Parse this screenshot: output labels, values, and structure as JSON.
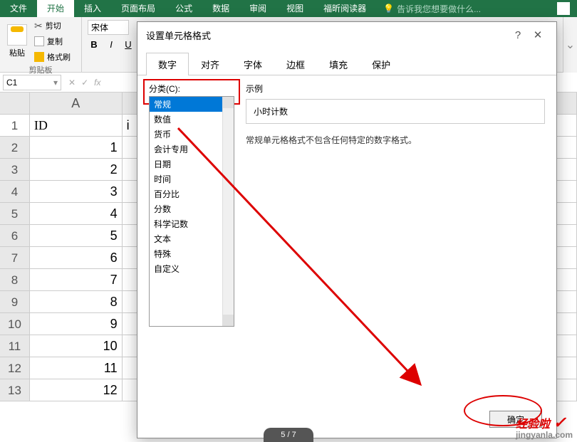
{
  "ribbon": {
    "tabs": [
      "文件",
      "开始",
      "插入",
      "页面布局",
      "公式",
      "数据",
      "审阅",
      "视图",
      "福昕阅读器"
    ],
    "active": "开始",
    "tell_me": "告诉我您想要做什么..."
  },
  "clipboard": {
    "paste": "粘贴",
    "cut": "剪切",
    "copy": "复制",
    "brush": "格式刷",
    "group": "剪贴板"
  },
  "font": {
    "name": "宋体",
    "bold": "B",
    "italic": "I",
    "underline": "U"
  },
  "formula_bar": {
    "name_box": "C1",
    "fx": "fx"
  },
  "sheet": {
    "columns": [
      "A"
    ],
    "col_b_partial": "i",
    "rows": [
      {
        "n": "1",
        "A": "ID"
      },
      {
        "n": "2",
        "A": "1"
      },
      {
        "n": "3",
        "A": "2"
      },
      {
        "n": "4",
        "A": "3"
      },
      {
        "n": "5",
        "A": "4"
      },
      {
        "n": "6",
        "A": "5"
      },
      {
        "n": "7",
        "A": "6"
      },
      {
        "n": "8",
        "A": "7"
      },
      {
        "n": "9",
        "A": "8"
      },
      {
        "n": "10",
        "A": "9"
      },
      {
        "n": "11",
        "A": "10"
      },
      {
        "n": "12",
        "A": "11"
      },
      {
        "n": "13",
        "A": "12"
      }
    ]
  },
  "dialog": {
    "title": "设置单元格格式",
    "tabs": [
      "数字",
      "对齐",
      "字体",
      "边框",
      "填充",
      "保护"
    ],
    "active_tab": "数字",
    "category_label": "分类(C):",
    "categories": [
      "常规",
      "数值",
      "货币",
      "会计专用",
      "日期",
      "时间",
      "百分比",
      "分数",
      "科学记数",
      "文本",
      "特殊",
      "自定义"
    ],
    "selected_category": "常规",
    "sample_label": "示例",
    "sample_value": "小时计数",
    "description": "常规单元格格式不包含任何特定的数字格式。",
    "ok": "确定"
  },
  "page_indicator": "5 / 7",
  "watermark": {
    "text": "经验啦",
    "url": "jingyanla.com"
  }
}
